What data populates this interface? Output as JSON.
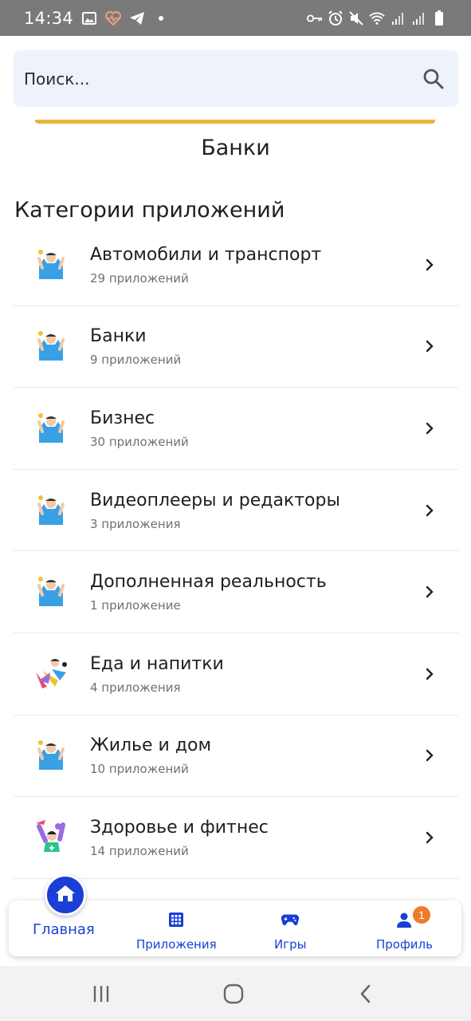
{
  "status_bar": {
    "time": "14:34",
    "left_icons": [
      "image-icon",
      "heart-pulse-icon",
      "telegram-icon",
      "dot-icon"
    ],
    "right_icons": [
      "key-icon",
      "alarm-icon",
      "mute-icon",
      "wifi-icon",
      "signal-icon",
      "signal-icon",
      "battery-icon"
    ]
  },
  "search": {
    "placeholder": "Поиск..."
  },
  "page_title": "Банки",
  "section_title": "Категории приложений",
  "categories": [
    {
      "name": "Автомобили и транспорт",
      "count": "29 приложений"
    },
    {
      "name": "Банки",
      "count": "9 приложений"
    },
    {
      "name": "Бизнес",
      "count": "30 приложений"
    },
    {
      "name": "Видеоплееры и редакторы",
      "count": "3 приложения"
    },
    {
      "name": "Дополненная реальность",
      "count": "1 приложение"
    },
    {
      "name": "Еда и напитки",
      "count": "4 приложения"
    },
    {
      "name": "Жилье и дом",
      "count": "10 приложений"
    },
    {
      "name": "Здоровье и фитнес",
      "count": "14 приложений"
    }
  ],
  "bottom_nav": {
    "home": "Главная",
    "apps": "Приложения",
    "games": "Игры",
    "profile": "Профиль",
    "profile_badge": "1"
  },
  "colors": {
    "accent": "#1a3fd6",
    "search_bg": "#eef2fb",
    "yellow": "#e9b43a",
    "badge": "#f07a2b"
  }
}
